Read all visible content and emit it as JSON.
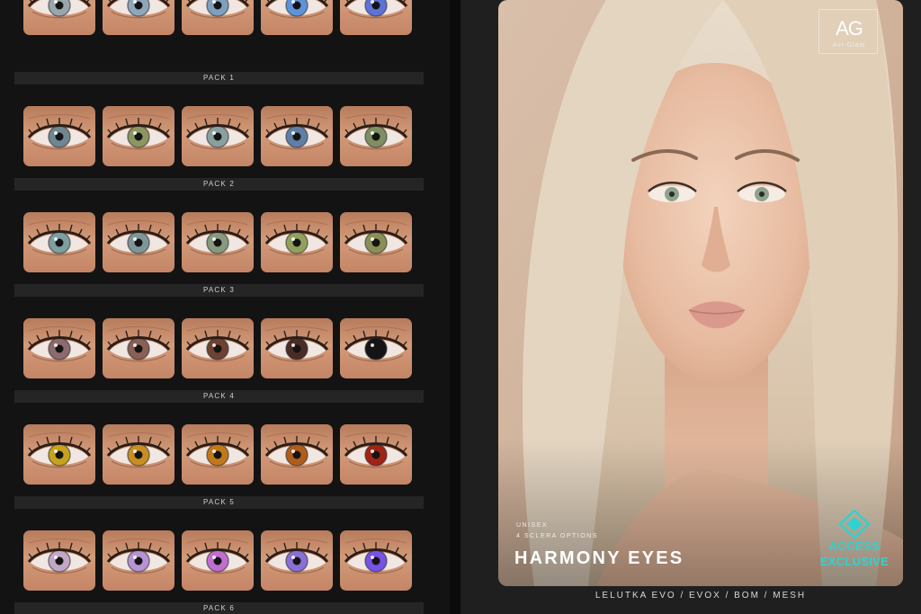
{
  "brand": {
    "logo": "AG",
    "logo_sub": "Avi-Glam"
  },
  "product": {
    "tag_1": "UNISEX",
    "tag_2": "4 SCLERA OPTIONS",
    "title": "HARMONY EYES"
  },
  "badge": {
    "line_1": "ACCESS",
    "line_2": "EXCLUSIVE",
    "color": "#2ed3d0"
  },
  "footer": {
    "compat": "LELUTKA EVO  /  EVOX  /  BOM  /  MESH"
  },
  "packs": [
    {
      "label": "PACK 1",
      "irises": [
        "#9aa6ad",
        "#8fa7bb",
        "#7f9fbf",
        "#5f92d8",
        "#5d73d6"
      ]
    },
    {
      "label": "PACK 2",
      "irises": [
        "#6f8791",
        "#8c9661",
        "#8aa0a0",
        "#5f7fa6",
        "#7f8f63"
      ]
    },
    {
      "label": "PACK 3",
      "irises": [
        "#7e9ea0",
        "#7f9698",
        "#889a7e",
        "#92a05e",
        "#8a8f56"
      ]
    },
    {
      "label": "PACK 4",
      "irises": [
        "#8d6a6e",
        "#8a5f55",
        "#6e4131",
        "#4a2c24",
        "#141416"
      ]
    },
    {
      "label": "PACK 5",
      "irises": [
        "#c7a21c",
        "#c98e23",
        "#c37818",
        "#b05d1b",
        "#a02416"
      ]
    },
    {
      "label": "PACK 6",
      "irises": [
        "#c3a7c6",
        "#b793d4",
        "#c06ed0",
        "#8a6fd6",
        "#7752e4"
      ]
    }
  ]
}
